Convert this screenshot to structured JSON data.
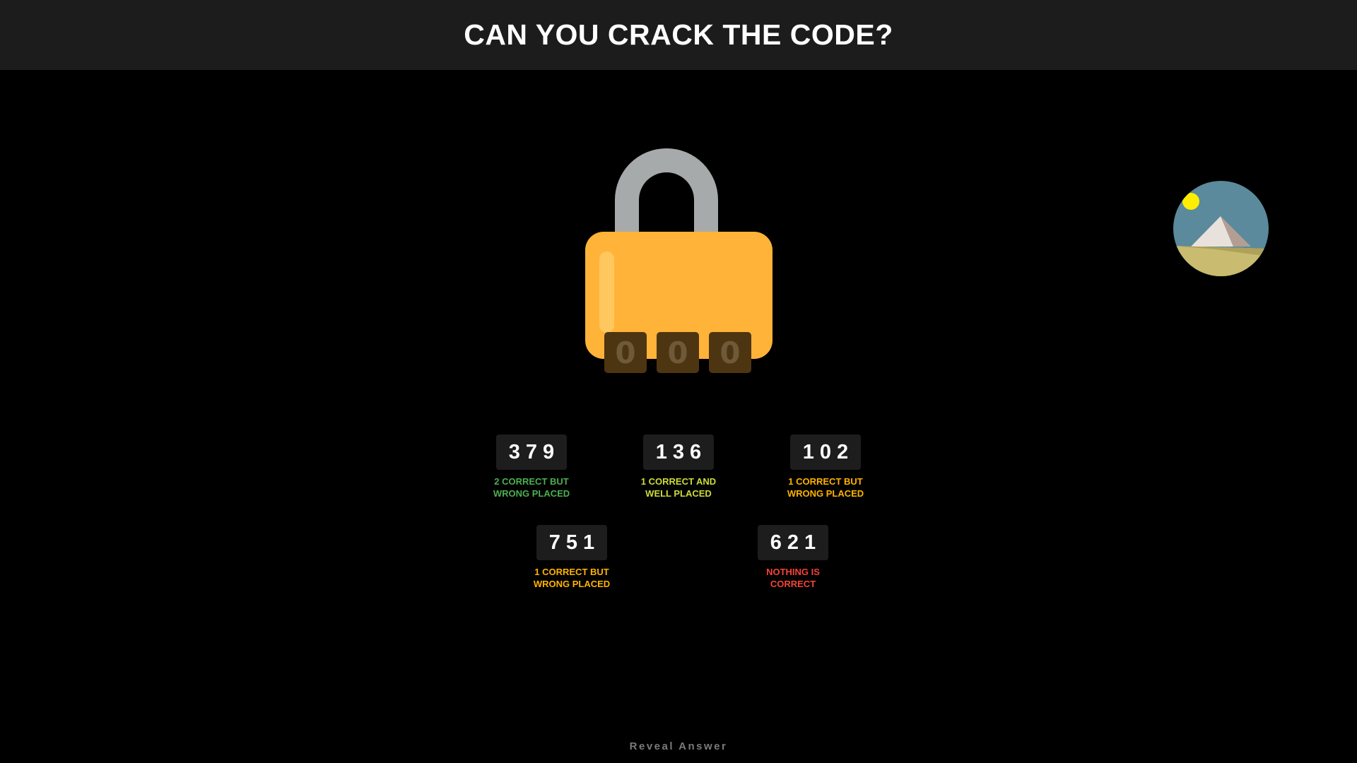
{
  "header": {
    "title": "CAN YOU CRACK THE CODE?"
  },
  "lock": {
    "dials": [
      "0",
      "0",
      "0"
    ]
  },
  "clues": [
    {
      "code": "379",
      "hint": "2 CORRECT BUT WRONG PLACED",
      "color": "#4caf50"
    },
    {
      "code": "136",
      "hint": "1 CORRECT AND WELL PLACED",
      "color": "#cddc39"
    },
    {
      "code": "102",
      "hint": "1 CORRECT BUT WRONG PLACED",
      "color": "#ffb300"
    },
    {
      "code": "751",
      "hint": "1 CORRECT BUT WRONG PLACED",
      "color": "#ffb300"
    },
    {
      "code": "621",
      "hint": "NOTHING IS CORRECT",
      "color": "#f44336"
    }
  ],
  "footer": {
    "reveal_label": "Reveal Answer"
  },
  "icons": {
    "lock": "padlock-icon",
    "scene": "pyramid-sun-image"
  }
}
